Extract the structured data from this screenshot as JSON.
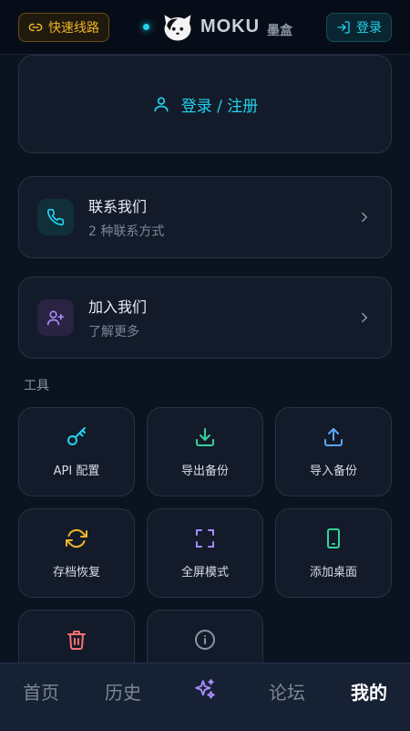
{
  "header": {
    "fast_route": "快速线路",
    "brand_name": "MOKU",
    "brand_sub": "墨盒",
    "login": "登录"
  },
  "login_card": {
    "label": "登录 / 注册"
  },
  "contact": {
    "title": "联系我们",
    "desc": "2 种联系方式"
  },
  "join": {
    "title": "加入我们",
    "desc": "了解更多"
  },
  "tools": {
    "section_label": "工具",
    "items": [
      {
        "label": "API 配置"
      },
      {
        "label": "导出备份"
      },
      {
        "label": "导入备份"
      },
      {
        "label": "存档恢复"
      },
      {
        "label": "全屏模式"
      },
      {
        "label": "添加桌面"
      }
    ]
  },
  "tabs": [
    {
      "label": "首页"
    },
    {
      "label": "历史"
    },
    {
      "label": "论坛"
    },
    {
      "label": "我的"
    }
  ],
  "colors": {
    "accent": "#22d3ee",
    "warning": "#f0b429",
    "purple": "#a78bfa",
    "green": "#34d399",
    "blue": "#60a5fa",
    "red": "#f87171"
  }
}
